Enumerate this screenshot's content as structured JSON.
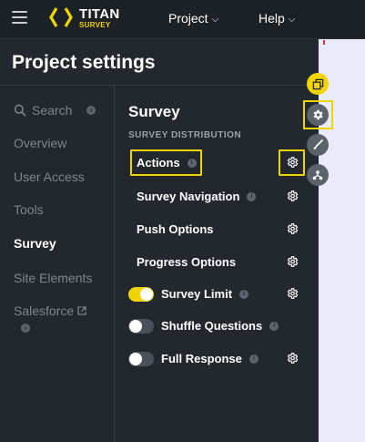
{
  "header": {
    "logo_title": "TITAN",
    "logo_subtitle": "SURVEY",
    "nav": [
      {
        "label": "Project"
      },
      {
        "label": "Help"
      }
    ]
  },
  "panel": {
    "title": "Project settings",
    "sidebar": {
      "search_label": "Search",
      "items": [
        {
          "label": "Overview"
        },
        {
          "label": "User Access"
        },
        {
          "label": "Tools"
        },
        {
          "label": "Survey",
          "active": true
        },
        {
          "label": "Site Elements"
        },
        {
          "label": "Salesforce"
        }
      ]
    },
    "content": {
      "title": "Survey",
      "subtitle": "SURVEY DISTRIBUTION",
      "rows": [
        {
          "label": "Actions",
          "info": true,
          "gear": true,
          "highlighted": true
        },
        {
          "label": "Survey Navigation",
          "info": true,
          "gear": true
        },
        {
          "label": "Push Options",
          "info": false,
          "gear": true
        },
        {
          "label": "Progress Options",
          "info": false,
          "gear": true
        },
        {
          "label": "Survey Limit",
          "info": true,
          "gear": true,
          "toggle": "on"
        },
        {
          "label": "Shuffle Questions",
          "info": true,
          "gear": false,
          "toggle": "off"
        },
        {
          "label": "Full Response",
          "info": true,
          "gear": true,
          "toggle": "off"
        }
      ]
    }
  },
  "toolbar": {
    "buttons": [
      {
        "icon": "layers-icon"
      },
      {
        "icon": "settings-icon",
        "highlighted": true
      },
      {
        "icon": "brush-icon"
      },
      {
        "icon": "share-nodes-icon"
      }
    ]
  },
  "colors": {
    "accent": "#f1d400",
    "panel_bg": "#22282e",
    "right_bg": "#e9ebf8"
  }
}
